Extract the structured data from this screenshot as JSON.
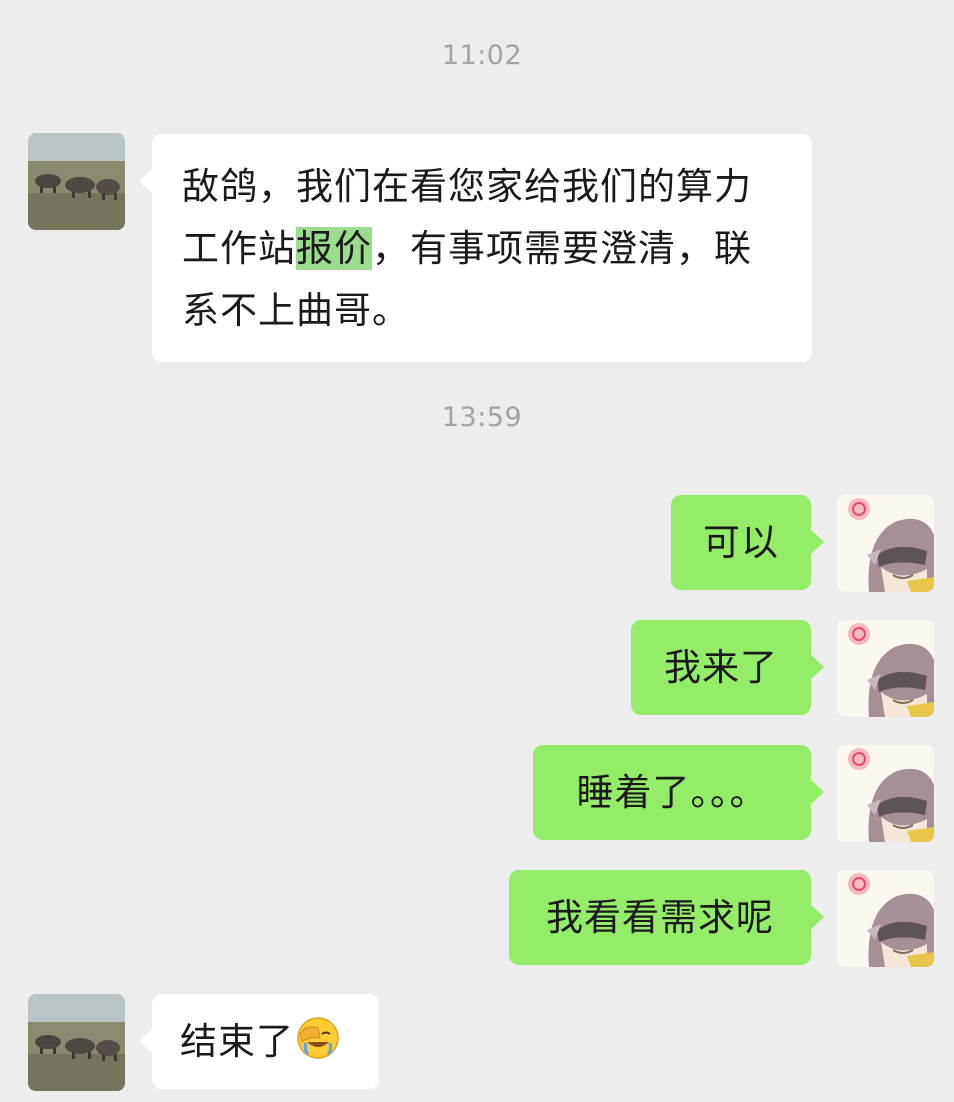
{
  "timestamps": {
    "first": "11:02",
    "second": "13:59"
  },
  "messages": [
    {
      "side": "left",
      "avatar": "rhino-photo-avatar",
      "text_before": "敌鸽，我们在看您家给我们的算力工作站",
      "text_highlight": "报价",
      "text_after": "，有事项需要澄清，联系不上曲哥。"
    },
    {
      "side": "right",
      "avatar": "anime-girl-avatar",
      "text": "可以"
    },
    {
      "side": "right",
      "avatar": "anime-girl-avatar",
      "text": "我来了"
    },
    {
      "side": "right",
      "avatar": "anime-girl-avatar",
      "text": "睡着了。。。"
    },
    {
      "side": "right",
      "avatar": "anime-girl-avatar",
      "text": "我看看需求呢"
    },
    {
      "side": "left",
      "avatar": "rhino-photo-avatar",
      "text": "结束了",
      "emoji": "facepalm-crying-emoji"
    }
  ],
  "colors": {
    "background": "#ededed",
    "incoming_bubble": "#ffffff",
    "outgoing_bubble": "#95ec69",
    "highlight": "#9bdc8e",
    "timestamp": "#a3a3a3"
  }
}
